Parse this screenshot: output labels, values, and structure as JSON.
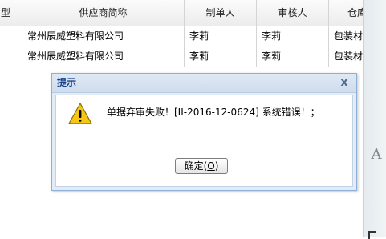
{
  "grid": {
    "columns": [
      "型",
      "供应商简称",
      "制单人",
      "审核人",
      "仓库"
    ],
    "rows": [
      {
        "supplier": "常州辰威塑料有限公司",
        "creator": "李莉",
        "reviewer": "李莉",
        "warehouse": "包装材"
      },
      {
        "supplier": "常州辰威塑料有限公司",
        "creator": "李莉",
        "reviewer": "李莉",
        "warehouse": "包装材"
      }
    ]
  },
  "side": {
    "font_icon_glyph": "A"
  },
  "dialog": {
    "title": "提示",
    "close_glyph": "x",
    "icon": "warning-icon",
    "message": "单据弃审失败！[II-2016-12-0624] 系统错误！；",
    "ok_label_prefix": "确定(",
    "ok_label_accel": "O",
    "ok_label_suffix": ")"
  },
  "colors": {
    "dialog_title_text": "#15428b",
    "dialog_border": "#8eb0d4",
    "warning_fill": "#f5c518"
  }
}
